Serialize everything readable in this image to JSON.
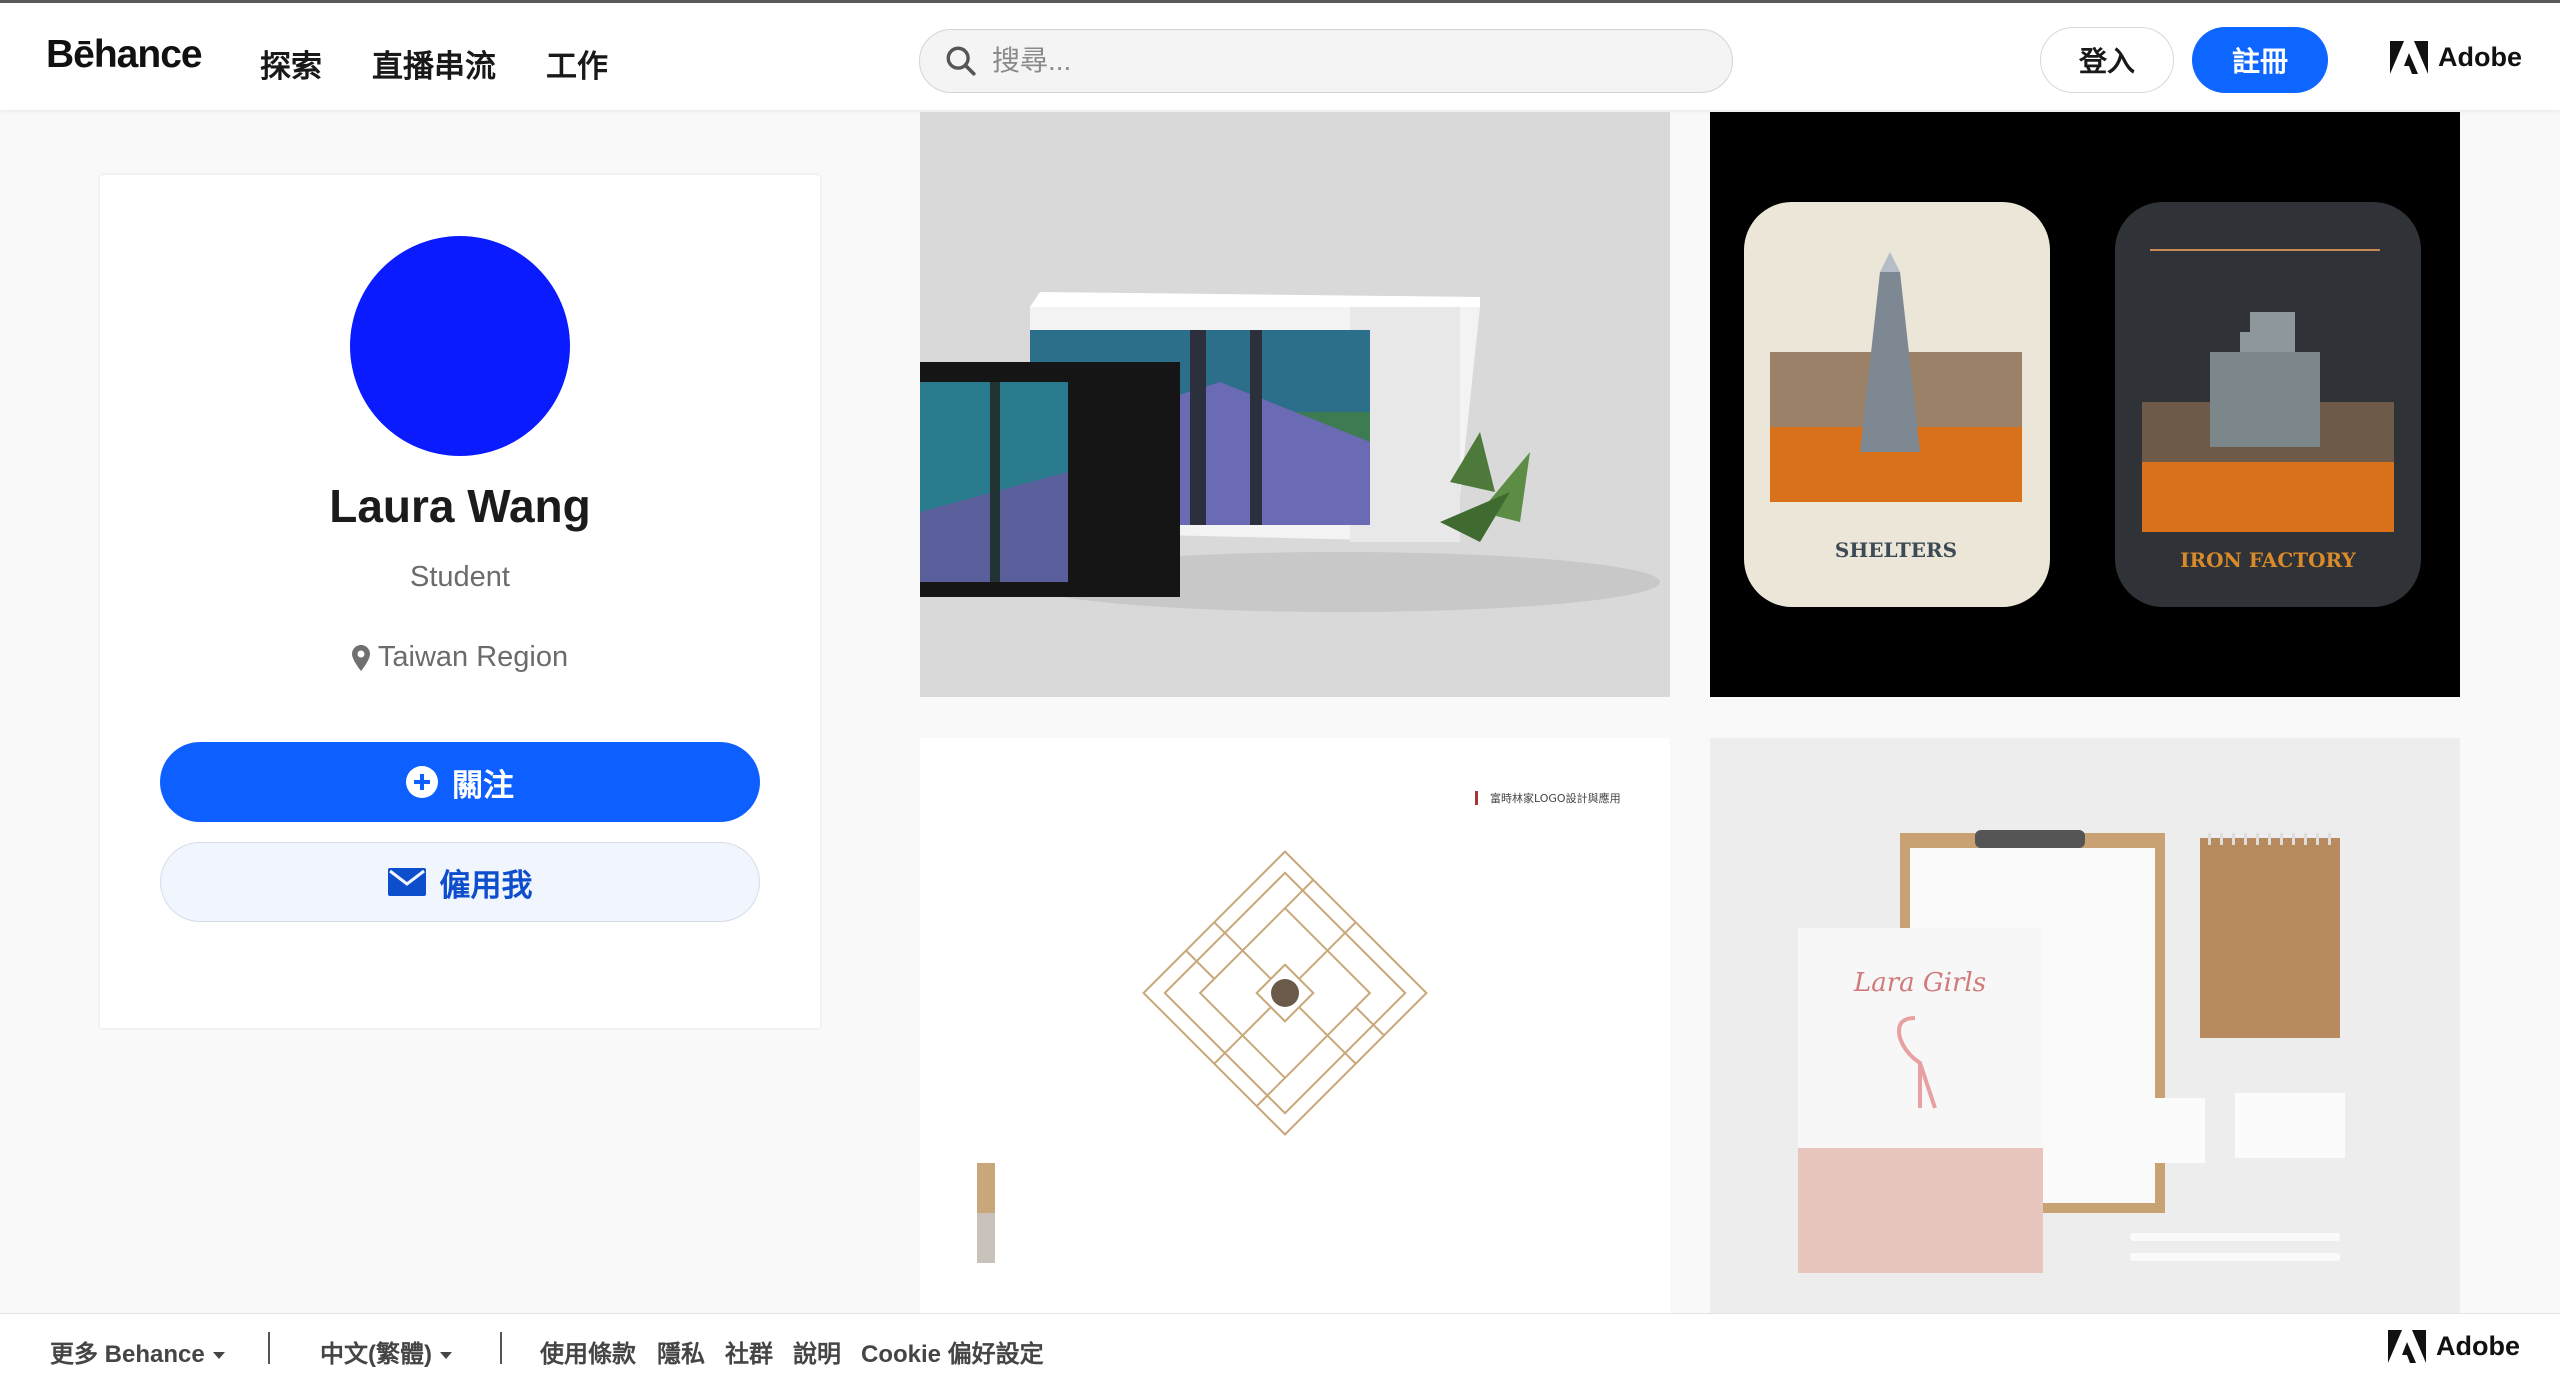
{
  "header": {
    "logo": "Bēhance",
    "nav": [
      "探索",
      "直播串流",
      "工作"
    ],
    "search_placeholder": "搜尋...",
    "login_label": "登入",
    "signup_label": "註冊",
    "adobe_label": "Adobe"
  },
  "profile": {
    "name": "Laura Wang",
    "occupation": "Student",
    "location": "Taiwan Region",
    "follow_label": "關注",
    "hire_label": "僱用我",
    "avatar_color": "#0a1bff"
  },
  "projects": [
    {
      "image": "packaging-mockup",
      "text": ""
    },
    {
      "image": "game-cards",
      "card_labels": [
        "SHELTERS",
        "IRON FACTORY"
      ]
    },
    {
      "image": "logo-design-sheet",
      "caption": "富時林家LOGO設計與應用"
    },
    {
      "image": "stationery-mockup",
      "brand": "Lara Girls"
    }
  ],
  "footer": {
    "more_behance": "更多 Behance",
    "language": "中文(繁體)",
    "links": [
      "使用條款",
      "隱私",
      "社群",
      "說明",
      "Cookie 偏好設定"
    ],
    "adobe_label": "Adobe"
  },
  "colors": {
    "primary": "#0d66ff",
    "avatar": "#0a1bff"
  }
}
